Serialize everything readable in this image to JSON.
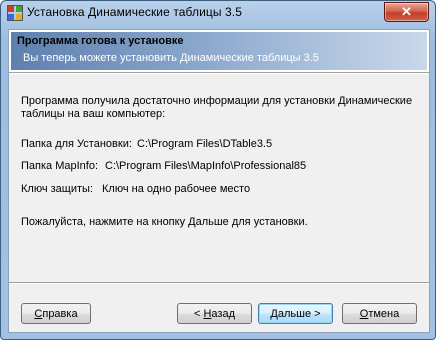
{
  "window": {
    "title": "Установка Динамические таблицы 3.5",
    "close_label": "✕"
  },
  "header": {
    "title": "Программа готова к установке",
    "subtitle": "Вы теперь можете установить Динамические таблицы 3.5"
  },
  "body": {
    "intro": "Программа получила достаточно информации для установки Динамические таблицы на ваш компьютер:",
    "install_folder": {
      "label": "Папка для Установки:",
      "value": "C:\\Program Files\\DTable3.5"
    },
    "mapinfo_folder": {
      "label": "Папка MapInfo:",
      "value": "C:\\Program Files\\MapInfo\\Professional85"
    },
    "license_key": {
      "label": "Ключ защиты:",
      "value": "Ключ на одно рабочее место"
    },
    "instruction": "Пожалуйста, нажмите на кнопку Дальше для установки."
  },
  "buttons": {
    "help": {
      "accel": "С",
      "rest": "правка"
    },
    "back": {
      "prefix": "< ",
      "accel": "Н",
      "rest": "азад"
    },
    "next": {
      "accel": "Д",
      "rest": "альше >"
    },
    "cancel": {
      "accel": "О",
      "rest": "тмена"
    }
  },
  "icons": {
    "app": "installer-app-icon",
    "close": "close-icon"
  }
}
